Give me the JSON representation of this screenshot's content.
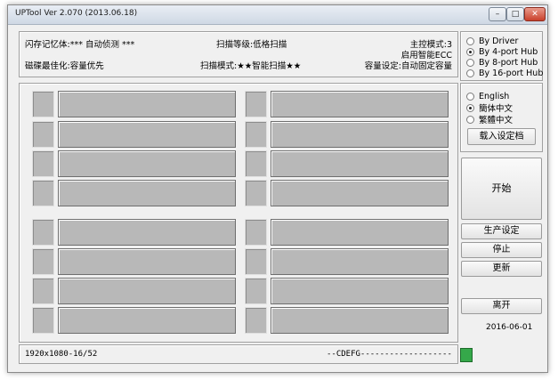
{
  "window": {
    "title": "UPTool Ver 2.070 (2013.06.18)"
  },
  "info": {
    "flash": "闪存记忆体:*** 自动侦测 ***",
    "scan_level": "扫描等级:低格扫描",
    "controller_mode": "主控模式:3",
    "optimize": "磁碟最佳化:容量优先",
    "scan_mode": "扫描模式:★★智能扫描★★",
    "ecc": "启用智能ECC",
    "capacity": "容量设定:自动固定容量"
  },
  "hub_options": [
    {
      "label": "By Driver",
      "selected": false
    },
    {
      "label": "By 4-port Hub",
      "selected": true
    },
    {
      "label": "By 8-port Hub",
      "selected": false
    },
    {
      "label": "By 16-port Hub",
      "selected": false
    }
  ],
  "language_options": [
    {
      "label": "English",
      "selected": false
    },
    {
      "label": "簡体中文",
      "selected": true
    },
    {
      "label": "繁體中文",
      "selected": false
    }
  ],
  "buttons": {
    "load_config": "载入设定档",
    "start": "开始",
    "production_settings": "生产设定",
    "stop": "停止",
    "update": "更新",
    "exit": "离开"
  },
  "datetime": {
    "date": "2016-06-01"
  },
  "status_bar": {
    "resolution": "1920x1080-16/52",
    "drives": "--CDEFG-------------------"
  }
}
